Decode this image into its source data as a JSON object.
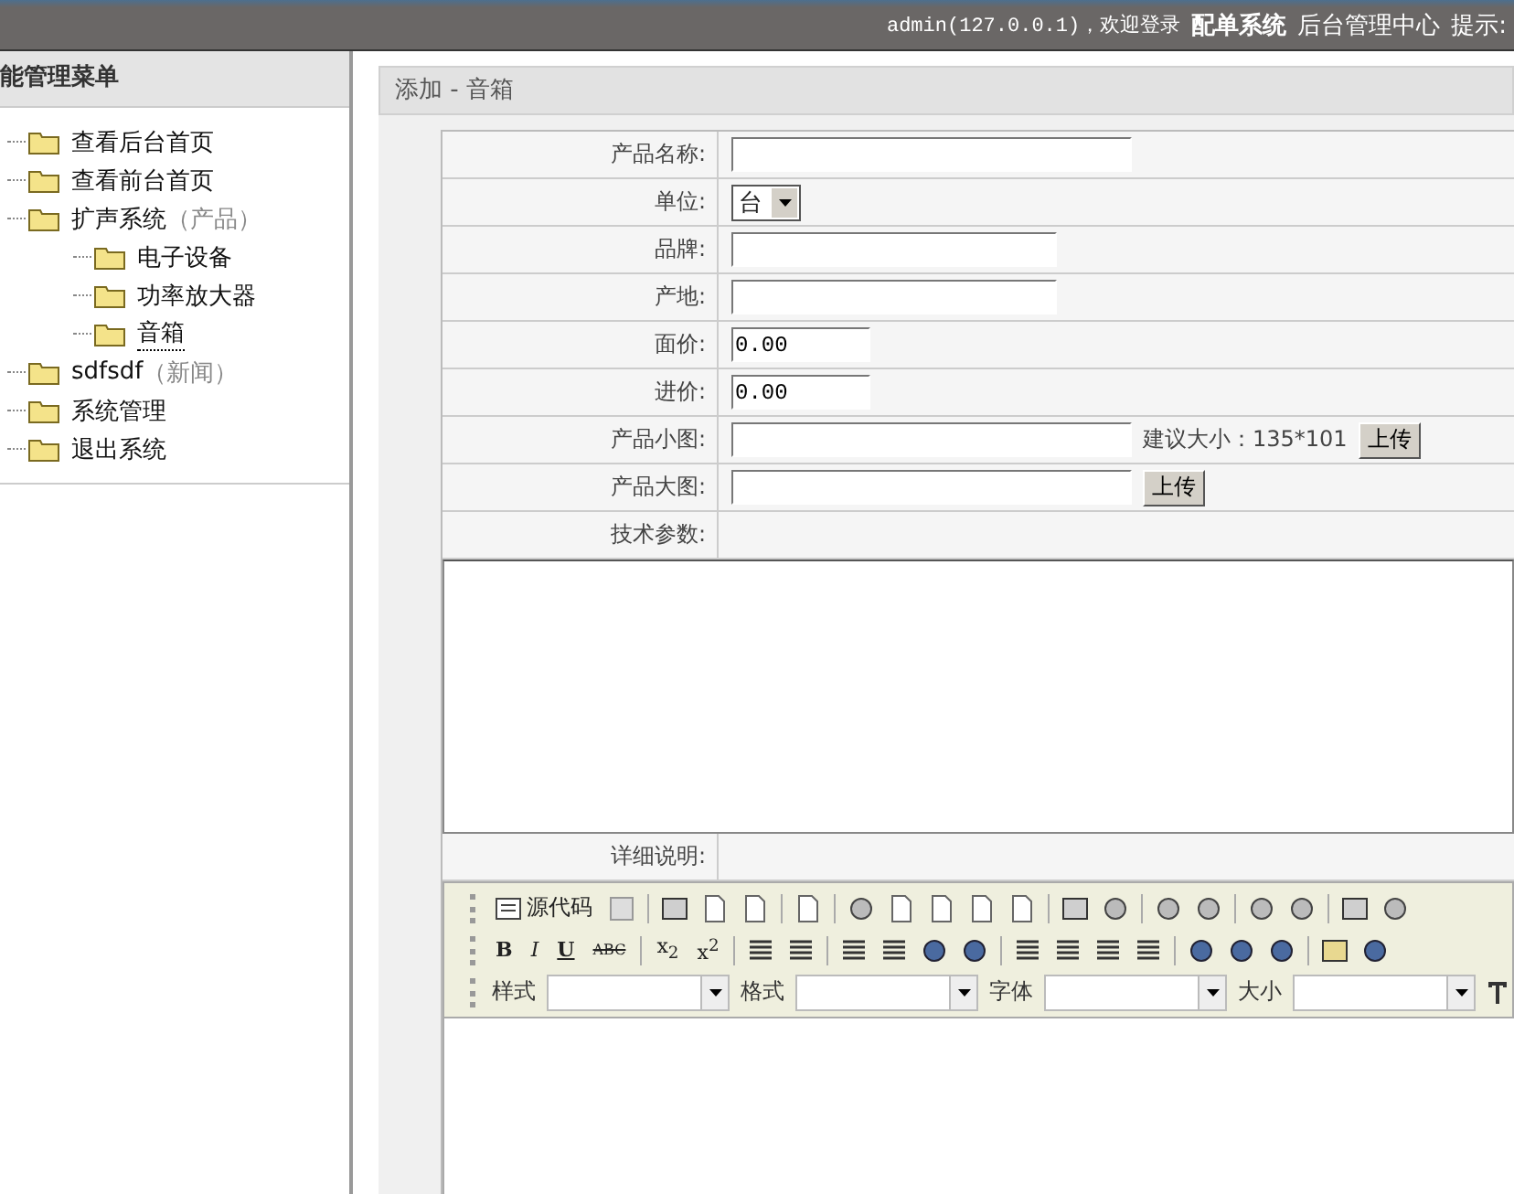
{
  "top_bar": {
    "user": "admin(127.0.0.1)，欢迎登录",
    "system_name": "配单系统",
    "center": "后台管理中心",
    "hint": "提示:"
  },
  "sidebar": {
    "title": "能管理菜单",
    "tree": [
      {
        "label": "查看后台首页",
        "selected": false
      },
      {
        "label": "查看前台首页",
        "selected": false
      },
      {
        "label": "扩声系统",
        "note": "（产品）",
        "selected": false,
        "children": [
          {
            "label": "电子设备",
            "selected": false
          },
          {
            "label": "功率放大器",
            "selected": false
          },
          {
            "label": "音箱",
            "selected": true
          }
        ]
      },
      {
        "label": "sdfsdf",
        "note": "（新闻）",
        "selected": false
      },
      {
        "label": "系统管理",
        "selected": false
      },
      {
        "label": "退出系统",
        "selected": false
      }
    ]
  },
  "panel": {
    "title": "添加 - 音箱"
  },
  "form": {
    "rows": [
      {
        "kind": "wide_text",
        "label": "产品名称:"
      },
      {
        "kind": "select",
        "label": "单位:",
        "value": "台"
      },
      {
        "kind": "text",
        "label": "品牌:"
      },
      {
        "kind": "text",
        "label": "产地:"
      },
      {
        "kind": "number",
        "label": "面价:",
        "value": "0.00"
      },
      {
        "kind": "number",
        "label": "进价:",
        "value": "0.00"
      },
      {
        "kind": "upload",
        "label": "产品小图:",
        "hint": "建议大小：135*101",
        "button": "上传"
      },
      {
        "kind": "upload",
        "label": "产品大图:",
        "button": "上传"
      },
      {
        "kind": "textarea",
        "label": "技术参数:"
      },
      {
        "kind": "editor",
        "label": "详细说明:"
      }
    ]
  },
  "editor": {
    "source_button": "源代码",
    "format_buttons": [
      "B",
      "I",
      "U",
      "ABC"
    ],
    "script_buttons": [
      "x$_{2}$",
      "x$^{2}$"
    ],
    "dropdowns": [
      {
        "label": "样式"
      },
      {
        "label": "格式"
      },
      {
        "label": "字体"
      },
      {
        "label": "大小"
      }
    ]
  }
}
